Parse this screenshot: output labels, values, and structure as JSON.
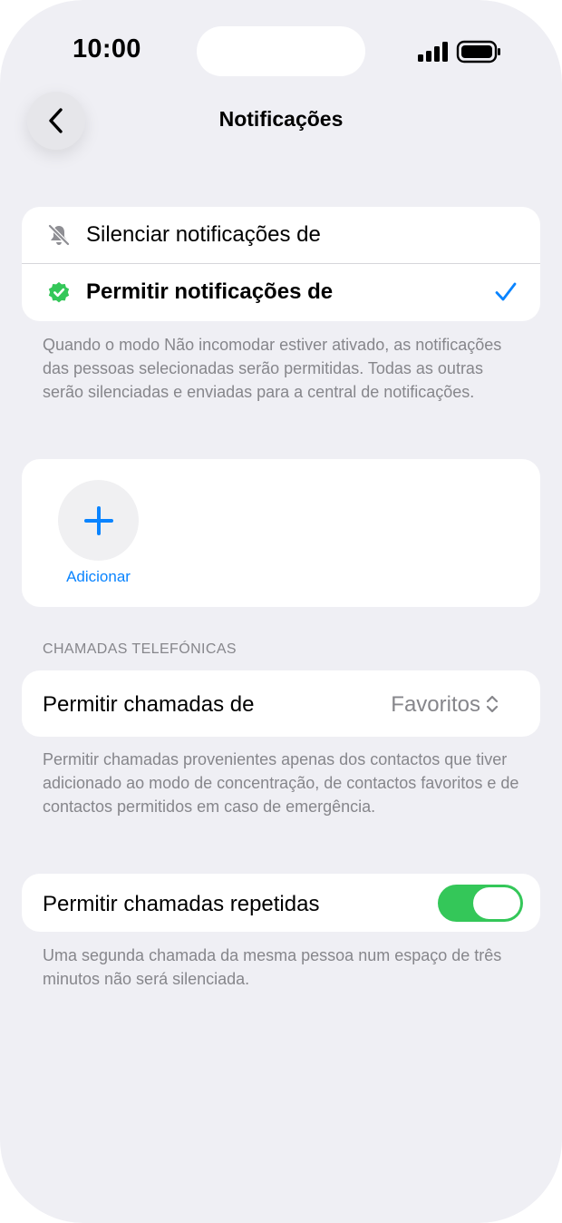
{
  "status_bar": {
    "time": "10:00"
  },
  "nav": {
    "title": "Notificações",
    "back_icon": "chevron-left-icon"
  },
  "notification_mode": {
    "options": [
      {
        "label": "Silenciar notificações de",
        "icon": "bell-slash-icon",
        "selected": false
      },
      {
        "label": "Permitir notificações de",
        "icon": "checkmark-seal-icon",
        "selected": true
      }
    ],
    "footnote": "Quando o modo Não incomodar estiver ativado, as notificações das pessoas selecionadas serão permitidas. Todas as outras serão silenciadas e enviadas para a central de notificações."
  },
  "people": {
    "add_label": "Adicionar"
  },
  "calls": {
    "section_header": "CHAMADAS TELEFÓNICAS",
    "allow_calls_label": "Permitir chamadas de",
    "allow_calls_value": "Favoritos",
    "allow_calls_footnote": "Permitir chamadas provenientes apenas dos contactos que tiver adicionado ao modo de concentração, de contactos favoritos e de contactos permitidos em caso de emergência.",
    "repeated_calls_label": "Permitir chamadas repetidas",
    "repeated_calls_on": true,
    "repeated_calls_footnote": "Uma segunda chamada da mesma pessoa num espaço de três minutos não será silenciada."
  },
  "colors": {
    "accent": "#0a84ff",
    "toggle_on": "#34c759",
    "seal_green": "#34c759",
    "background": "#efeff4"
  }
}
